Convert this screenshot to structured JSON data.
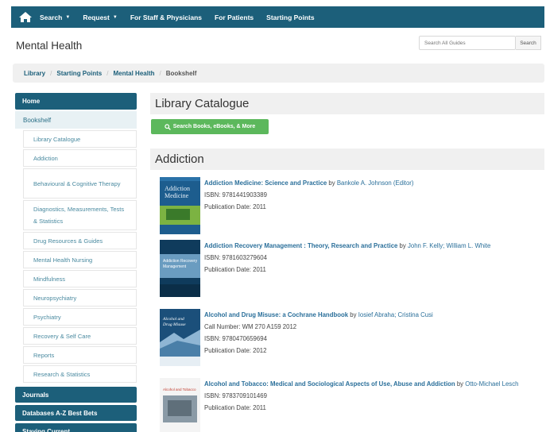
{
  "nav": {
    "items": [
      {
        "label": "Search",
        "dropdown": true
      },
      {
        "label": "Request",
        "dropdown": true
      },
      {
        "label": "For Staff & Physicians",
        "dropdown": false
      },
      {
        "label": "For Patients",
        "dropdown": false
      },
      {
        "label": "Starting Points",
        "dropdown": false
      }
    ]
  },
  "header": {
    "title": "Mental Health",
    "search_placeholder": "Search All Guides",
    "search_button": "Search"
  },
  "breadcrumb": {
    "items": [
      "Library",
      "Starting Points",
      "Mental Health"
    ],
    "current": "Bookshelf"
  },
  "sidebar": {
    "home": "Home",
    "bookshelf": "Bookshelf",
    "subitems": [
      "Library Catalogue",
      "Addiction",
      "Behavioural & Cognitive Therapy",
      "Diagnostics, Measurements, Tests & Statistics",
      "Drug Resources & Guides",
      "Mental Health Nursing",
      "Mindfulness",
      "Neuropsychiatry",
      "Psychiatry",
      "Recovery & Self Care",
      "Reports",
      "Research & Statistics"
    ],
    "bottom": [
      "Journals",
      "Databases A-Z Best Bets",
      "Staying Current"
    ]
  },
  "main": {
    "catalogue_heading": "Library Catalogue",
    "catalogue_button": "Search Books, eBooks, & More",
    "addiction_heading": "Addiction",
    "books": [
      {
        "title": "Addiction Medicine: Science and Practice",
        "author": "Bankole A. Johnson (Editor)",
        "lines": [
          "ISBN: 9781441903389",
          "Publication Date: 2011"
        ],
        "cover_text": [
          "Addiction",
          "Medicine"
        ]
      },
      {
        "title": "Addiction Recovery Management : Theory, Research and Practice",
        "author": "John F. Kelly; William L. White",
        "lines": [
          "ISBN: 9781603279604",
          "Publication Date: 2011"
        ],
        "cover_text": [
          "Addiction Recovery",
          "Management"
        ]
      },
      {
        "title": "Alcohol and Drug Misuse: a Cochrane Handbook",
        "author": "Iosief Abraha; Cristina Cusi",
        "lines": [
          "Call Number: WM 270 A159 2012",
          "ISBN: 9780470659694",
          "Publication Date: 2012"
        ],
        "cover_text": [
          "Alcohol and",
          "Drug Misuse"
        ]
      },
      {
        "title": "Alcohol and Tobacco: Medical and Sociological Aspects of Use, Abuse and Addiction",
        "author": "Otto-Michael Lesch",
        "lines": [
          "ISBN: 9783709101469",
          "Publication Date: 2011"
        ],
        "cover_text": [
          "Alcohol and Tobacco"
        ]
      }
    ]
  },
  "colors": {
    "brand": "#1c5f7a",
    "link": "#2a6f9a",
    "button_green": "#5cb85c"
  }
}
